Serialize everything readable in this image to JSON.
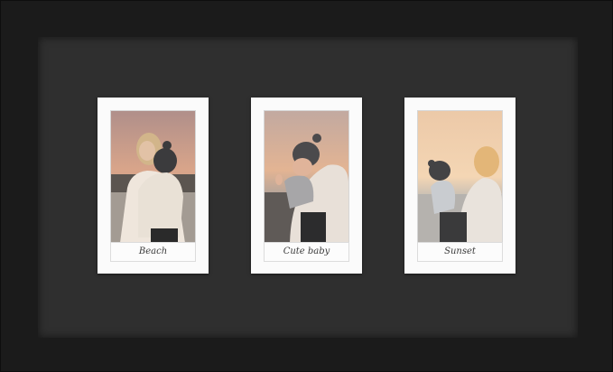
{
  "photos": [
    {
      "caption": "Beach"
    },
    {
      "caption": "Cute baby"
    },
    {
      "caption": "Sunset"
    }
  ],
  "colors": {
    "frame": "#1b1b1b",
    "mat": "#2f2f2f",
    "card": "#fbfbfb"
  }
}
